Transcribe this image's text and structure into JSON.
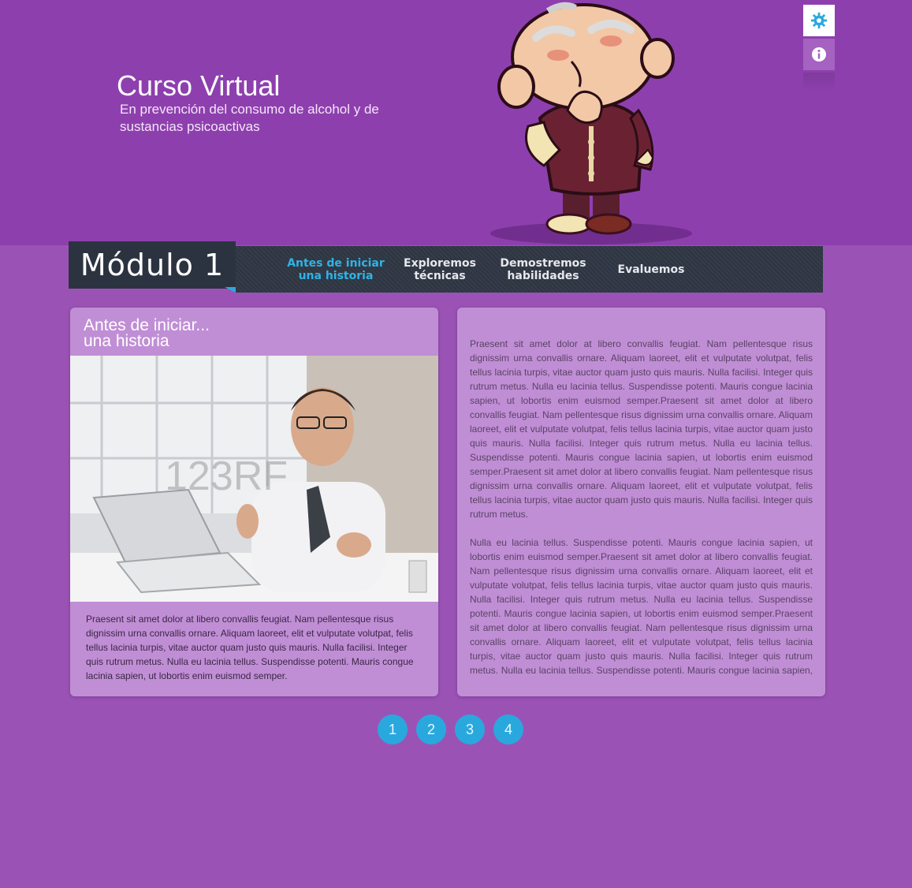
{
  "header": {
    "title": "Curso Virtual",
    "subtitle": "En prevención del consumo de alcohol y de sustancias psicoactivas"
  },
  "tools": {
    "settings_icon": "gear-icon",
    "info_icon": "info-icon"
  },
  "module": {
    "label": "Módulo 1"
  },
  "nav": {
    "items": [
      {
        "label": "Antes de iniciar una historia",
        "active": true
      },
      {
        "label": "Exploremos técnicas",
        "active": false
      },
      {
        "label": "Demostremos habilidades",
        "active": false
      },
      {
        "label": "Evaluemos",
        "active": false
      }
    ]
  },
  "left_card": {
    "title_line1": "Antes de iniciar...",
    "title_line2": "una historia",
    "photo_watermark": "123RF",
    "text": "Praesent sit amet dolor at libero convallis feugiat. Nam pellentesque risus dignissim urna convallis ornare. Aliquam laoreet, elit et vulputate volutpat, felis tellus lacinia turpis, vitae auctor quam justo quis mauris. Nulla facilisi. Integer quis rutrum metus. Nulla eu lacinia tellus. Suspendisse potenti. Mauris congue lacinia sapien, ut lobortis enim euismod semper."
  },
  "right_card": {
    "paragraph1": "Praesent sit amet dolor at libero convallis feugiat. Nam pellentesque risus dignissim urna convallis ornare. Aliquam laoreet, elit et vulputate volutpat, felis tellus lacinia turpis, vitae auctor quam justo quis mauris. Nulla facilisi. Integer quis rutrum metus. Nulla eu lacinia tellus. Suspendisse potenti. Mauris congue lacinia sapien, ut lobortis enim euismod semper.Praesent sit amet dolor at libero convallis feugiat. Nam pellentesque risus dignissim urna convallis ornare. Aliquam laoreet, elit et vulputate volutpat, felis tellus lacinia turpis, vitae auctor quam justo quis mauris. Nulla facilisi. Integer quis rutrum metus. Nulla eu lacinia tellus. Suspendisse potenti. Mauris congue lacinia sapien, ut lobortis enim euismod semper.Praesent sit amet dolor at libero convallis feugiat. Nam pellentesque risus dignissim urna convallis ornare. Aliquam laoreet, elit et vulputate volutpat, felis tellus lacinia turpis, vitae auctor quam justo quis mauris. Nulla facilisi. Integer quis rutrum metus.",
    "paragraph2": "Nulla eu lacinia tellus. Suspendisse potenti. Mauris congue lacinia sapien, ut lobortis enim euismod semper.Praesent sit amet dolor at libero convallis feugiat. Nam pellentesque risus dignissim urna convallis ornare. Aliquam laoreet, elit et vulputate volutpat, felis tellus lacinia turpis, vitae auctor quam justo quis mauris. Nulla facilisi. Integer quis rutrum metus. Nulla eu lacinia tellus. Suspendisse potenti. Mauris congue lacinia sapien, ut lobortis enim euismod semper.Praesent sit amet dolor at libero convallis feugiat. Nam pellentesque risus dignissim urna convallis ornare. Aliquam laoreet, elit et vulputate volutpat, felis tellus lacinia turpis, vitae auctor quam justo quis mauris. Nulla facilisi. Integer quis rutrum metus. Nulla eu lacinia tellus. Suspendisse potenti. Mauris congue lacinia sapien, ut lobortis"
  },
  "pager": {
    "pages": [
      "1",
      "2",
      "3",
      "4"
    ]
  },
  "colors": {
    "background": "#9a53b5",
    "header": "#8e3fae",
    "card": "#c08ed5",
    "nav_bar": "#2e3541",
    "accent": "#29a8de"
  }
}
